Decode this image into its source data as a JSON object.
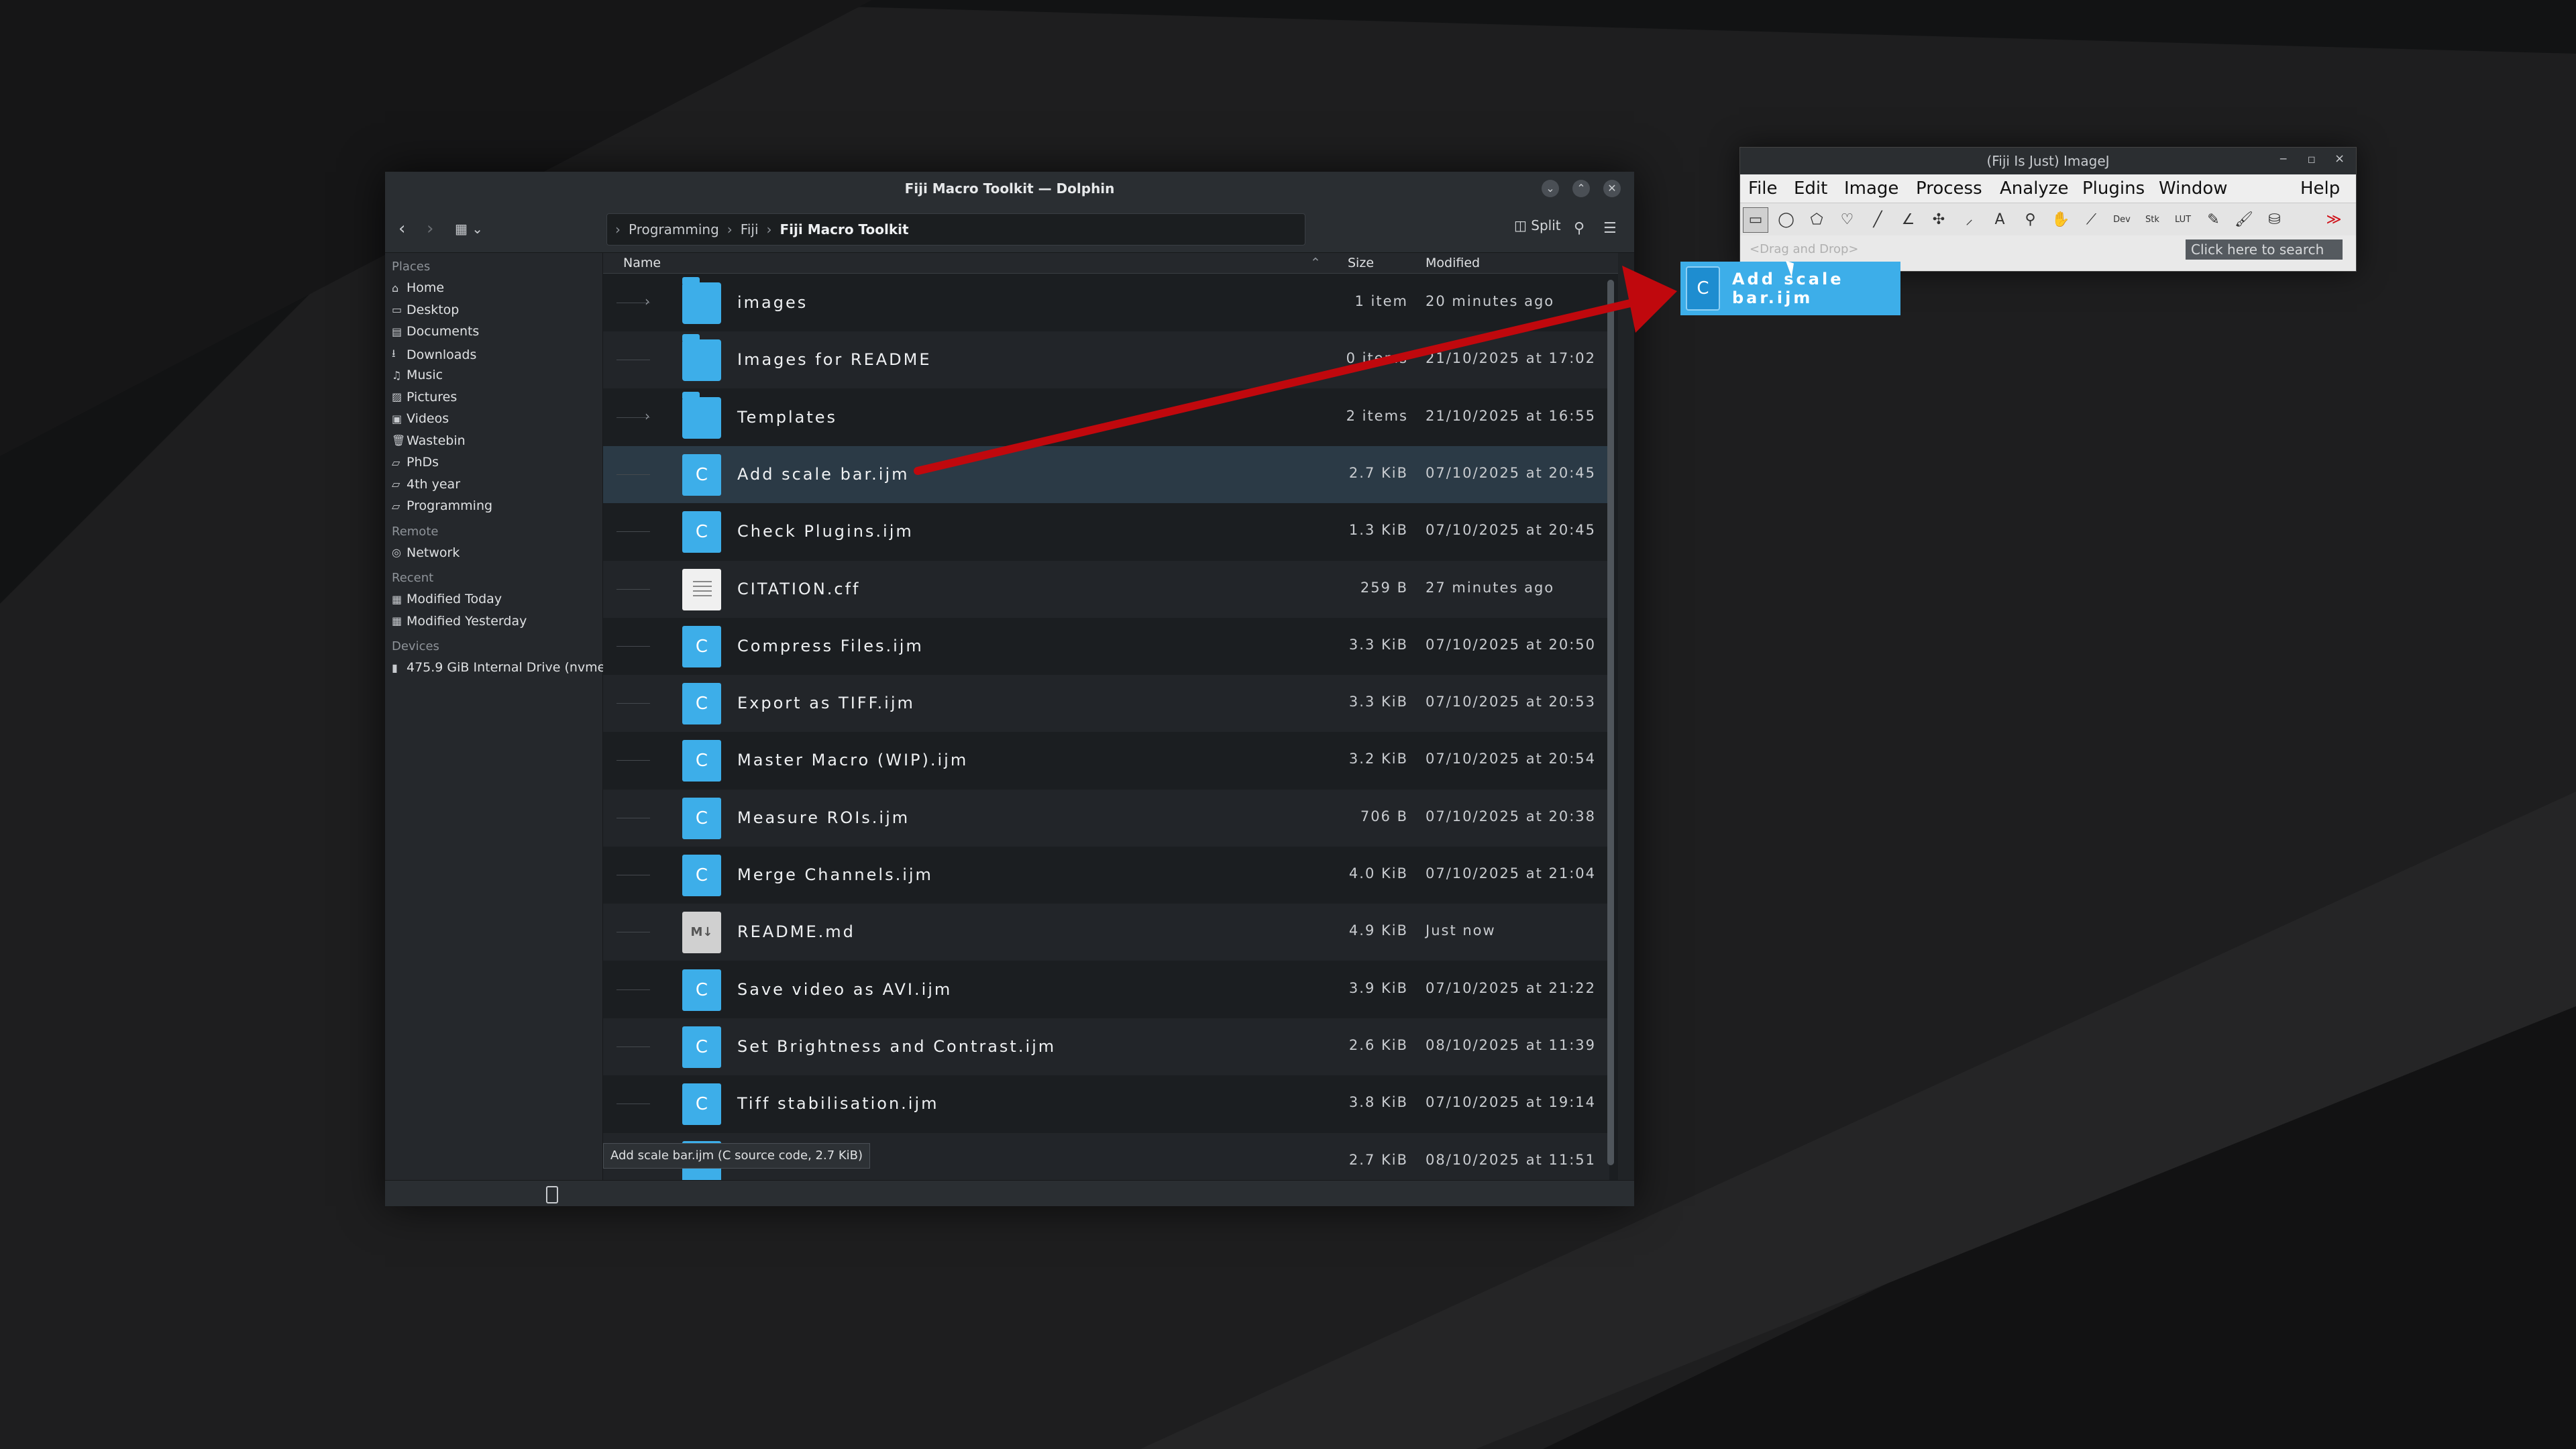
{
  "dolphin": {
    "title": "Fiji Macro Toolkit — Dolphin",
    "breadcrumb": [
      "Programming",
      "Fiji",
      "Fiji Macro Toolkit"
    ],
    "split_label": "Split",
    "sidebar": {
      "places_header": "Places",
      "places": [
        {
          "label": "Home",
          "icon": "home-icon"
        },
        {
          "label": "Desktop",
          "icon": "desktop-icon"
        },
        {
          "label": "Documents",
          "icon": "documents-icon"
        },
        {
          "label": "Downloads",
          "icon": "downloads-icon"
        },
        {
          "label": "Music",
          "icon": "music-icon"
        },
        {
          "label": "Pictures",
          "icon": "pictures-icon"
        },
        {
          "label": "Videos",
          "icon": "videos-icon"
        },
        {
          "label": "Wastebin",
          "icon": "trash-icon"
        },
        {
          "label": "PhDs",
          "icon": "folder-icon"
        },
        {
          "label": "4th year",
          "icon": "folder-icon"
        },
        {
          "label": "Programming",
          "icon": "folder-icon"
        }
      ],
      "remote_header": "Remote",
      "remote": [
        {
          "label": "Network",
          "icon": "network-icon"
        }
      ],
      "recent_header": "Recent",
      "recent": [
        {
          "label": "Modified Today",
          "icon": "calendar-icon"
        },
        {
          "label": "Modified Yesterday",
          "icon": "calendar-icon"
        }
      ],
      "devices_header": "Devices",
      "devices": [
        {
          "label": "475.9 GiB Internal Drive (nvme...",
          "icon": "drive-icon"
        }
      ]
    },
    "columns": {
      "name": "Name",
      "size": "Size",
      "modified": "Modified"
    },
    "files": [
      {
        "name": "images",
        "type": "folder",
        "size": "1 item",
        "modified": "20 minutes ago",
        "expandable": true
      },
      {
        "name": "Images for README",
        "type": "folder",
        "size": "0 items",
        "modified": "21/10/2025 at 17:02",
        "expandable": false
      },
      {
        "name": "Templates",
        "type": "folder",
        "size": "2 items",
        "modified": "21/10/2025 at 16:55",
        "expandable": true
      },
      {
        "name": "Add scale bar.ijm",
        "type": "c",
        "size": "2.7 KiB",
        "modified": "07/10/2025 at 20:45",
        "selected": true
      },
      {
        "name": "Check Plugins.ijm",
        "type": "c",
        "size": "1.3 KiB",
        "modified": "07/10/2025 at 20:45"
      },
      {
        "name": "CITATION.cff",
        "type": "doc",
        "size": "259 B",
        "modified": "27 minutes ago"
      },
      {
        "name": "Compress Files.ijm",
        "type": "c",
        "size": "3.3 KiB",
        "modified": "07/10/2025 at 20:50"
      },
      {
        "name": "Export as TIFF.ijm",
        "type": "c",
        "size": "3.3 KiB",
        "modified": "07/10/2025 at 20:53"
      },
      {
        "name": "Master Macro (WIP).ijm",
        "type": "c",
        "size": "3.2 KiB",
        "modified": "07/10/2025 at 20:54"
      },
      {
        "name": "Measure ROIs.ijm",
        "type": "c",
        "size": "706 B",
        "modified": "07/10/2025 at 20:38"
      },
      {
        "name": "Merge Channels.ijm",
        "type": "c",
        "size": "4.0 KiB",
        "modified": "07/10/2025 at 21:04"
      },
      {
        "name": "README.md",
        "type": "md",
        "size": "4.9 KiB",
        "modified": "Just now"
      },
      {
        "name": "Save video as AVI.ijm",
        "type": "c",
        "size": "3.9 KiB",
        "modified": "07/10/2025 at 21:22"
      },
      {
        "name": "Set Brightness and Contrast.ijm",
        "type": "c",
        "size": "2.6 KiB",
        "modified": "08/10/2025 at 11:39"
      },
      {
        "name": "Tiff stabilisation.ijm",
        "type": "c",
        "size": "3.8 KiB",
        "modified": "07/10/2025 at 19:14"
      },
      {
        "name": "",
        "type": "c",
        "size": "2.7 KiB",
        "modified": "08/10/2025 at 11:51"
      }
    ],
    "tooltip": "Add scale bar.ijm (C source code, 2.7 KiB)"
  },
  "imagej": {
    "title": "(Fiji Is Just) ImageJ",
    "menus": [
      "File",
      "Edit",
      "Image",
      "Process",
      "Analyze",
      "Plugins",
      "Window",
      "Help"
    ],
    "tools": [
      {
        "icon": "rectangle-tool-icon",
        "glyph": "▭"
      },
      {
        "icon": "oval-tool-icon",
        "glyph": "◯"
      },
      {
        "icon": "polygon-tool-icon",
        "glyph": "⬠"
      },
      {
        "icon": "freehand-tool-icon",
        "glyph": "♡"
      },
      {
        "icon": "line-tool-icon",
        "glyph": "╱"
      },
      {
        "icon": "angle-tool-icon",
        "glyph": "∠"
      },
      {
        "icon": "point-tool-icon",
        "glyph": "✣"
      },
      {
        "icon": "wand-tool-icon",
        "glyph": "⸝"
      },
      {
        "icon": "text-tool-icon",
        "glyph": "A"
      },
      {
        "icon": "zoom-tool-icon",
        "glyph": "⚲"
      },
      {
        "icon": "hand-tool-icon",
        "glyph": "✋"
      },
      {
        "icon": "dropper-tool-icon",
        "glyph": "⟋"
      },
      {
        "icon": "dev-tool-icon",
        "glyph": "Dev"
      },
      {
        "icon": "stk-tool-icon",
        "glyph": "Stk"
      },
      {
        "icon": "lut-tool-icon",
        "glyph": "LUT"
      },
      {
        "icon": "pencil-tool-icon",
        "glyph": "✎"
      },
      {
        "icon": "brush-tool-icon",
        "glyph": "🖌"
      },
      {
        "icon": "flood-fill-tool-icon",
        "glyph": "⛁"
      },
      {
        "icon": "more-tools-icon",
        "glyph": "≫"
      }
    ],
    "status_hint": "<Drag and Drop>",
    "search_placeholder": "Click here to search"
  },
  "drag_ghost": {
    "label": "Add scale bar.ijm",
    "icon": "c-source-file-icon"
  },
  "colors": {
    "accent": "#3daee9",
    "arrow": "#c0080d",
    "selection": "#2b3a46"
  }
}
